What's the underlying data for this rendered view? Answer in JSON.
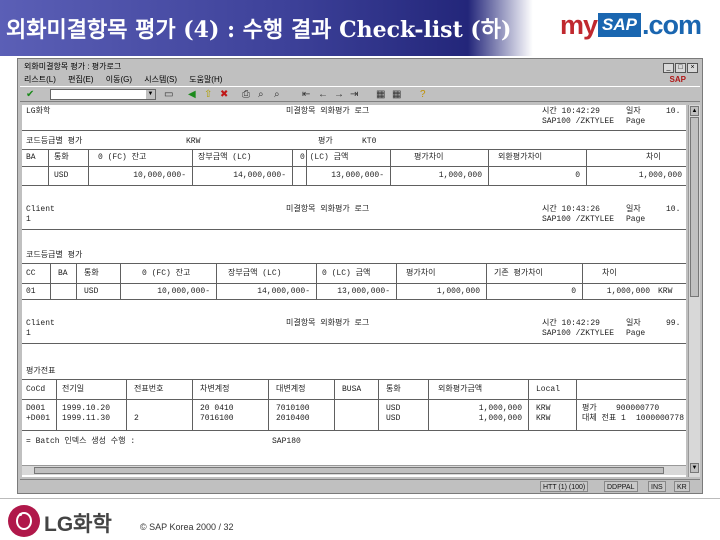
{
  "slide": {
    "title": "외화미결항목 평가 (4) : 수행 결과 Check-list (하)",
    "brand_my": "my",
    "brand_sap": "SAP",
    "brand_com": ".com",
    "footer_company": "LG화학",
    "footer_copyright": "© SAP Korea 2000 / 32",
    "colors": {
      "header_left": "#5b5fb6",
      "header_dark": "#23267a",
      "brand_red": "#c0282e",
      "brand_blue": "#1a66b0",
      "lg_red": "#b0184a"
    }
  },
  "window": {
    "title": "외화미결항목 평가 : 평가로그",
    "menu": [
      "리스트(L)",
      "편집(E)",
      "이동(G)",
      "시스템(S)",
      "도움말(H)"
    ],
    "menu_right": "SAP",
    "icons": [
      "check-icon",
      "save-icon",
      "back-icon",
      "exit-icon",
      "cancel-icon",
      "print-icon",
      "find-icon",
      "find-next-icon",
      "first-page-icon",
      "prev-page-icon",
      "next-page-icon",
      "last-page-icon",
      "help-icon"
    ]
  },
  "report": {
    "sec1": {
      "company": "LG화학",
      "heading": "미결항목 외화평가 로그",
      "time": "시간 10:42:29",
      "date_label": "일자",
      "date_value": "10.",
      "user": "SAP100 /ZKTYLEE",
      "page": "Page"
    },
    "group1": {
      "title": "코드등급별 평가",
      "currency_label": "KRW",
      "rate_label": "평가",
      "rate_value": "KT0"
    },
    "table1": {
      "headers": [
        "BA",
        "통화",
        "0 (FC) 잔고",
        "장부금액 (LC)",
        "0 (LC) 금액",
        "평가차이",
        "외환평가차이",
        "차이"
      ],
      "row": [
        "",
        "USD",
        "10,000,000-",
        "14,000,000-",
        "",
        "13,000,000-",
        "1,000,000",
        "0",
        "1,000,000"
      ]
    },
    "sec2": {
      "company": "Client",
      "sub": "1",
      "heading": "미결항목 외화평가 로그",
      "time": "시간 10:43:26",
      "date_label": "일자",
      "date_value": "10.",
      "user": "SAP100 /ZKTYLEE",
      "page": "Page"
    },
    "group2": {
      "title": "코드등급별 평가"
    },
    "table2": {
      "headers": [
        "CC",
        "BA",
        "통화",
        "0 (FC) 잔고",
        "장부금액 (LC)",
        "0 (LC) 금액",
        "평가차이",
        "기존 평가차이",
        "차이"
      ],
      "row": [
        "01",
        "",
        "USD",
        "10,000,000-",
        "14,000,000-",
        "13,000,000-",
        "1,000,000",
        "0",
        "1,000,000",
        "KRW"
      ]
    },
    "sec3": {
      "company": "Client",
      "sub": "1",
      "heading": "미결항목 외화평가 로그",
      "time": "시간 10:42:29",
      "date_label": "일자",
      "date_value": "99.",
      "user": "SAP100 /ZKTYLEE",
      "page": "Page"
    },
    "group3": {
      "title": "평가전표"
    },
    "table3": {
      "headers": [
        "CoCd",
        "전기일",
        "전표번호",
        "차변계정",
        "대변계정",
        "BUSA",
        "통화",
        "외화평가금액",
        "Local"
      ],
      "rows": [
        [
          "D001",
          "1999.10.20",
          "",
          "20 0410",
          "7010100",
          "",
          "USD",
          "1,000,000",
          "KRW",
          "평가",
          "900000770"
        ],
        [
          "+D001",
          "1999.11.30",
          "2",
          "7016100",
          "2010400",
          "",
          "USD",
          "1,000,000",
          "KRW",
          "대체 전표 1",
          "1000000778"
        ]
      ]
    },
    "footer_note": "= Batch 인덱스 생성 수행 :",
    "footer_value": "SAP180"
  },
  "status": {
    "segments": [
      "HTT (1) (100)",
      "DDPPAL",
      "INS",
      "KR"
    ]
  }
}
